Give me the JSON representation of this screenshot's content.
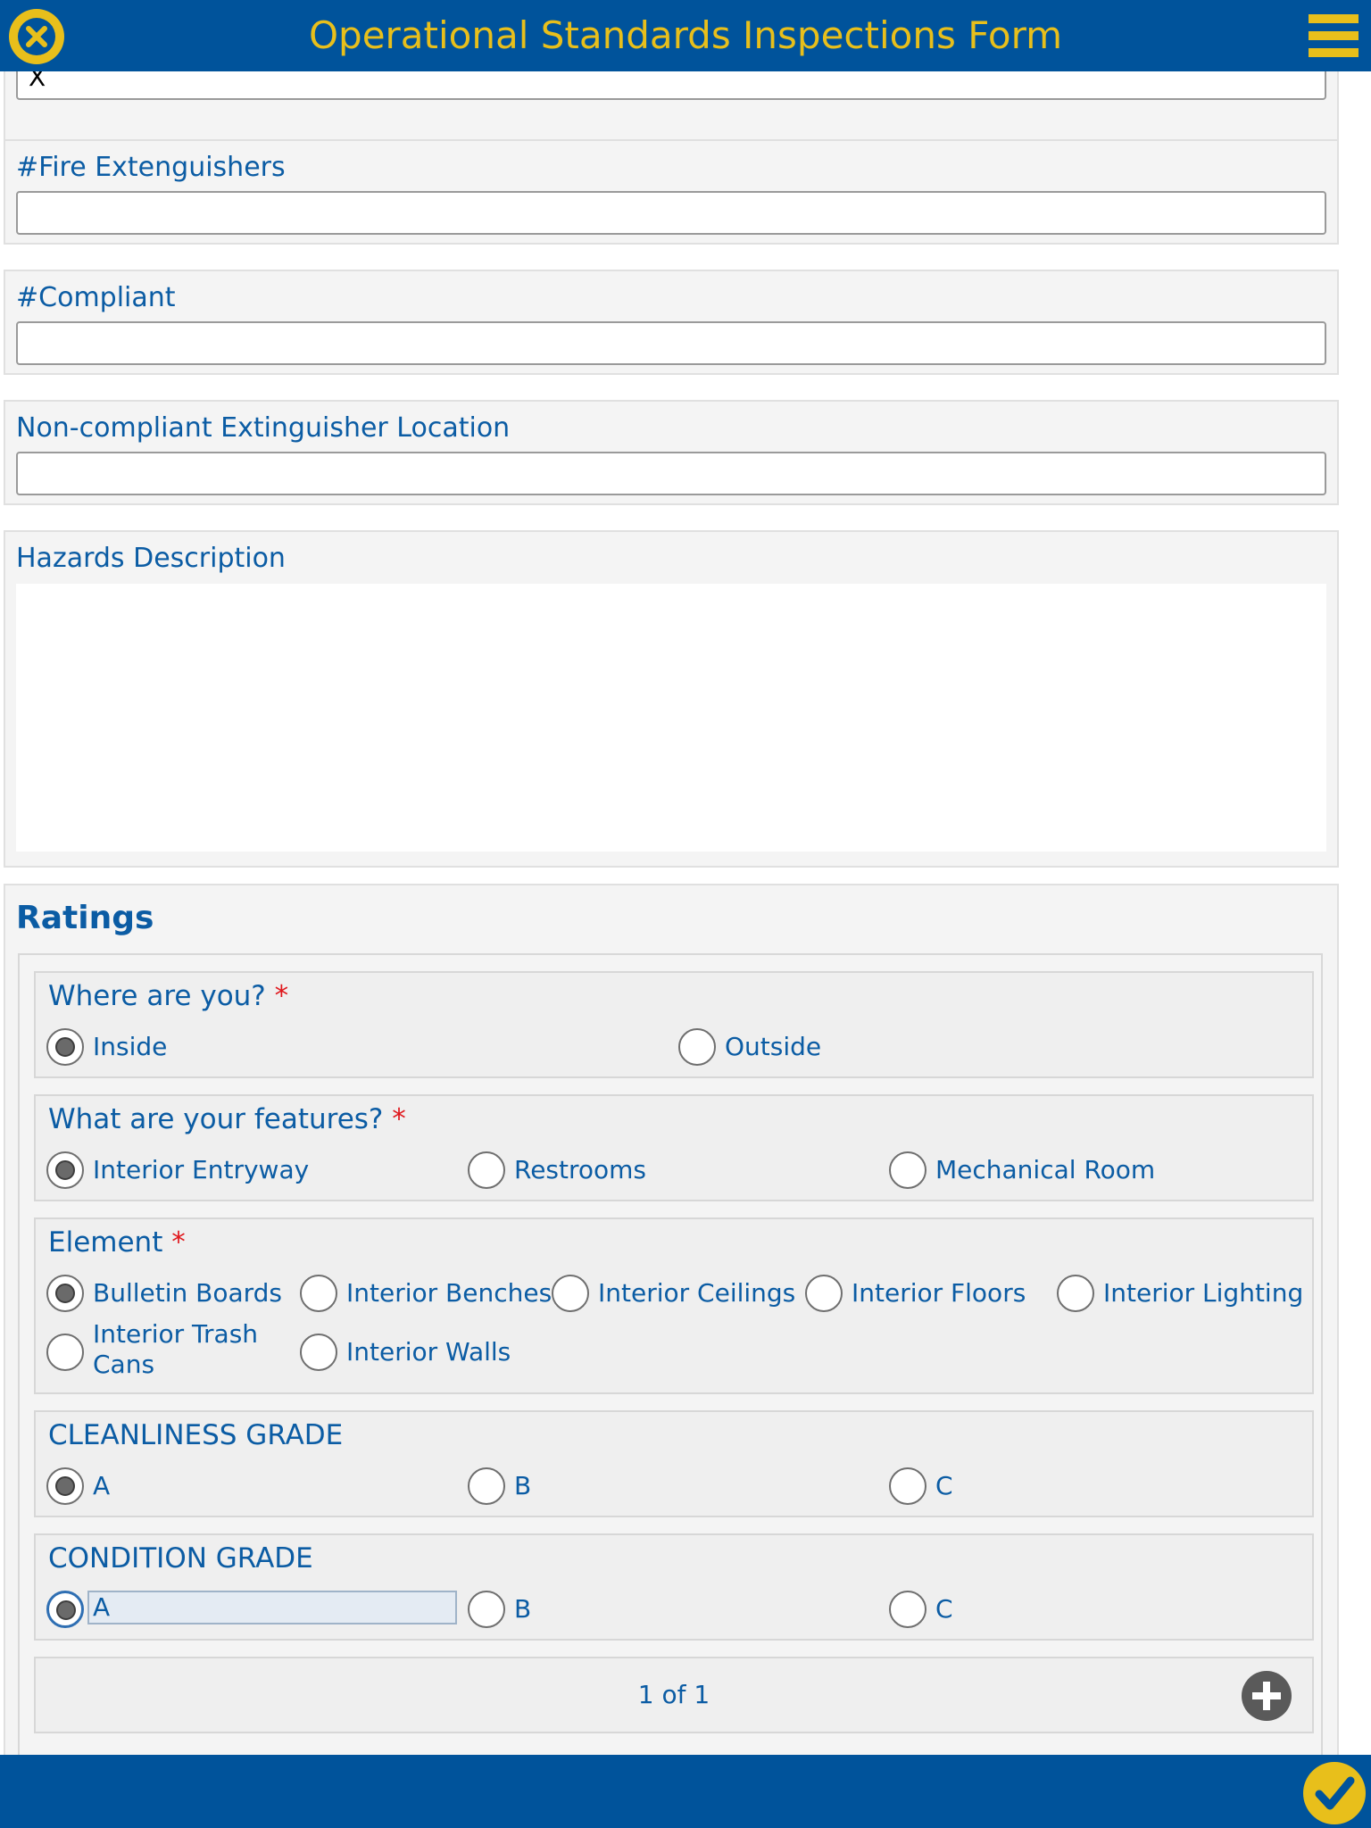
{
  "header": {
    "title": "Operational Standards Inspections Form",
    "close_icon": "close-icon",
    "menu_icon": "menu-icon"
  },
  "fields": {
    "prev_value": "X",
    "fire_ext_label": "#Fire Extenguishers",
    "fire_ext_value": "",
    "compliant_label": "#Compliant",
    "compliant_value": "",
    "noncompliant_label": "Non-compliant Extinguisher Location",
    "noncompliant_value": "",
    "hazards_label": "Hazards Description",
    "hazards_value": ""
  },
  "ratings": {
    "title": "Ratings",
    "required_mark": "*",
    "where": {
      "label": "Where are you?",
      "options": [
        "Inside",
        "Outside"
      ],
      "selected": "Inside"
    },
    "features": {
      "label": "What are your features?",
      "options": [
        "Interior Entryway",
        "Restrooms",
        "Mechanical Room"
      ],
      "selected": "Interior Entryway"
    },
    "element": {
      "label": "Element",
      "options": [
        "Bulletin Boards",
        "Interior Benches",
        "Interior Ceilings",
        "Interior Floors",
        "Interior Lighting",
        "Interior Trash Cans",
        "Interior Walls"
      ],
      "selected": "Bulletin Boards"
    },
    "cleanliness": {
      "label": "CLEANLINESS GRADE",
      "options": [
        "A",
        "B",
        "C"
      ],
      "selected": "A"
    },
    "condition": {
      "label": "CONDITION GRADE",
      "options": [
        "A",
        "B",
        "C"
      ],
      "selected": "A"
    },
    "pager": "1 of 1"
  },
  "footer": {
    "done_icon": "checkmark-icon"
  },
  "colors": {
    "brand_blue": "#00539b",
    "accent_yellow": "#e8bf1b",
    "text_blue": "#0b5ca4",
    "required_red": "#e0171c"
  }
}
